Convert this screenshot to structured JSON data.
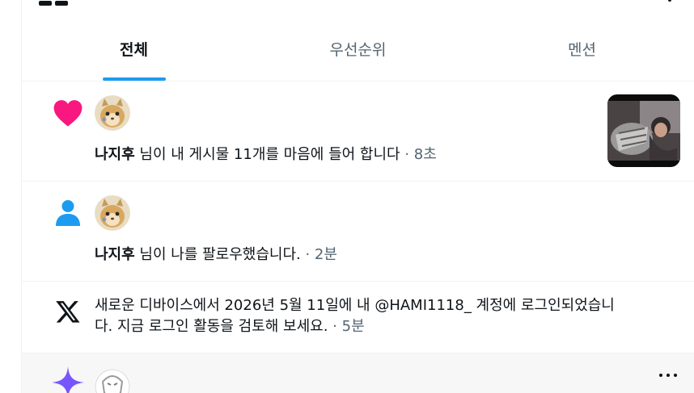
{
  "tabs": [
    {
      "label": "전체",
      "active": true
    },
    {
      "label": "우선순위",
      "active": false
    },
    {
      "label": "멘션",
      "active": false
    }
  ],
  "notifications": [
    {
      "type": "like",
      "icon": "heart-icon",
      "user": "나지후",
      "message": " 님이 내 게시물 11개를 마음에 들어 합니다",
      "time": " · 8초",
      "has_thumbnail": true
    },
    {
      "type": "follow",
      "icon": "person-icon",
      "user": "나지후",
      "message": " 님이 나를 팔로우했습니다.",
      "time": " · 2분"
    },
    {
      "type": "login",
      "icon": "x-logo-icon",
      "line1": "새로운 디바이스에서 2026년 5월 11일에 내 @HAMI1118_ 계정에 로그인되었습니",
      "line2": "다. 지금 로그인 활동을 검토해 보세요.",
      "time": " · 5분"
    },
    {
      "type": "spark",
      "icon": "sparkle-icon"
    }
  ],
  "colors": {
    "accent": "#1d9bf0",
    "heart": "#f91880",
    "sparkle": "#7856ff",
    "secondary_text": "#536471"
  }
}
